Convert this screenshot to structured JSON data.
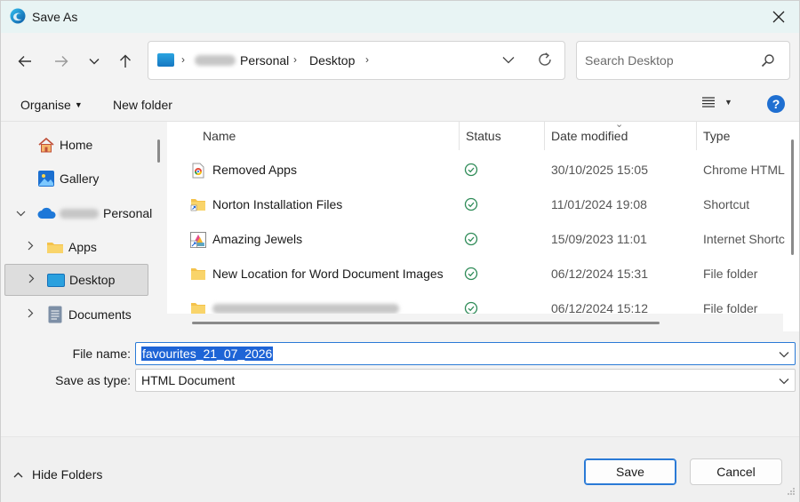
{
  "window": {
    "title": "Save As",
    "close_icon": "close-icon"
  },
  "nav": {
    "back_icon": "arrow-left-icon",
    "forward_icon": "arrow-right-icon",
    "recent_icon": "chevron-down-icon",
    "up_icon": "arrow-up-icon"
  },
  "address": {
    "segments": [
      "Personal",
      "Desktop"
    ],
    "refresh_icon": "refresh-icon"
  },
  "search": {
    "placeholder": "Search Desktop"
  },
  "toolbar": {
    "organise_label": "Organise",
    "new_folder_label": "New folder",
    "view_icon": "view-list-icon",
    "help_label": "?"
  },
  "sidebar": {
    "items": [
      {
        "label": "Home",
        "icon": "home-icon"
      },
      {
        "label": "Gallery",
        "icon": "gallery-icon"
      },
      {
        "label": "Personal",
        "icon": "cloud-icon"
      },
      {
        "label": "Apps",
        "icon": "folder-icon"
      },
      {
        "label": "Desktop",
        "icon": "desktop-icon"
      },
      {
        "label": "Documents",
        "icon": "documents-icon"
      }
    ]
  },
  "filelist": {
    "columns": [
      "Name",
      "Status",
      "Date modified",
      "Type"
    ],
    "rows": [
      {
        "name": "Removed Apps",
        "date": "30/10/2025 15:05",
        "type": "Chrome HTML",
        "icon": "chrome-html-icon"
      },
      {
        "name": "Norton Installation Files",
        "date": "11/01/2024 19:08",
        "type": "Shortcut",
        "icon": "folder-shortcut-icon"
      },
      {
        "name": "Amazing Jewels",
        "date": "15/09/2023 11:01",
        "type": "Internet Shortc",
        "icon": "internet-shortcut-icon"
      },
      {
        "name": "New Location for Word Document Images",
        "date": "06/12/2024 15:31",
        "type": "File folder",
        "icon": "folder-icon"
      },
      {
        "name": "",
        "date": "06/12/2024 15:12",
        "type": "File folder",
        "icon": "folder-icon"
      }
    ],
    "status_icon": "synced-check-icon"
  },
  "form": {
    "filename_label": "File name:",
    "filename_value": "favourites_21_07_2026",
    "type_label": "Save as type:",
    "type_value": "HTML Document"
  },
  "footer": {
    "hide_folders_label": "Hide Folders",
    "save_label": "Save",
    "cancel_label": "Cancel"
  },
  "colors": {
    "accent": "#1e64d6",
    "title_bar": "#e8f4f4",
    "status_green": "#2e8b57"
  }
}
